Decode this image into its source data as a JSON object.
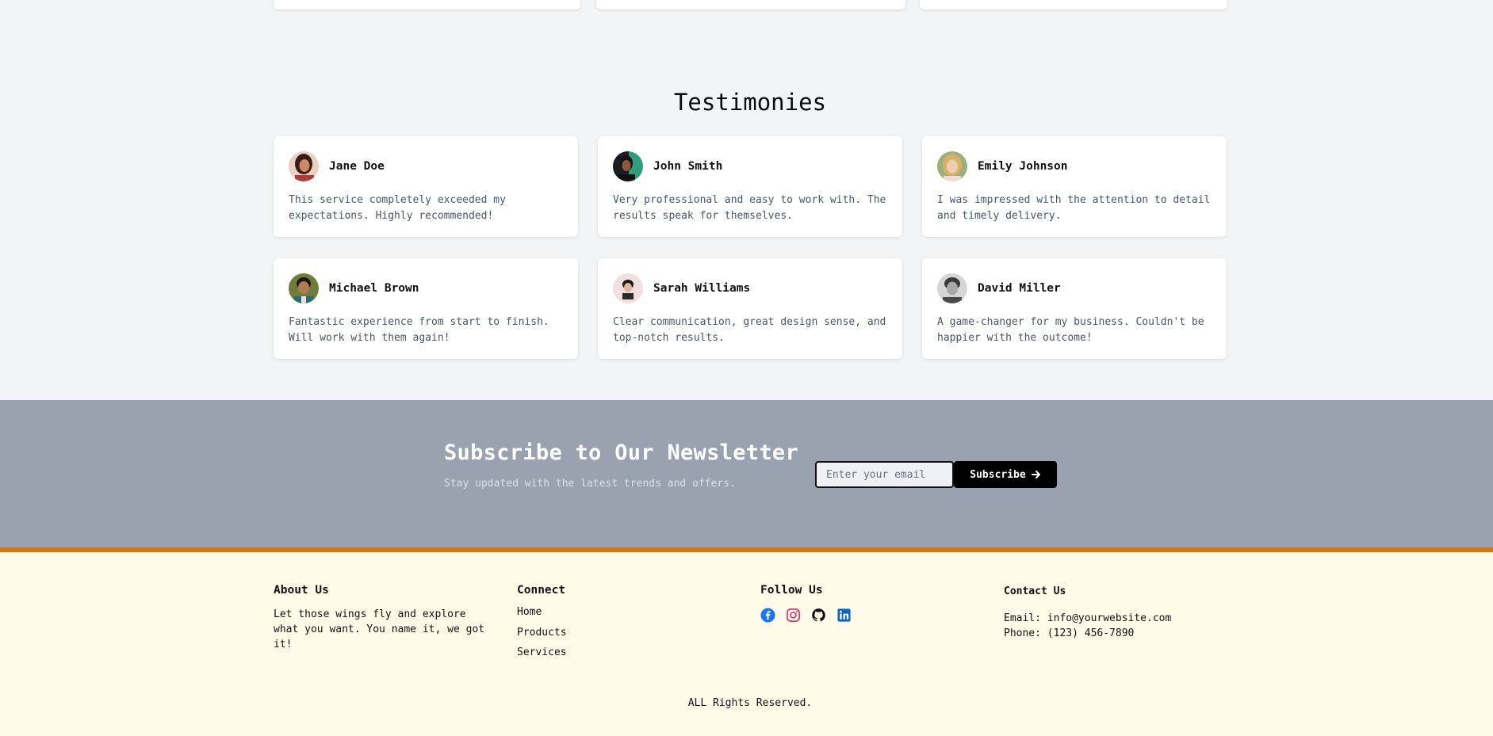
{
  "testimonies": {
    "title": "Testimonies",
    "items": [
      {
        "name": "Jane Doe",
        "quote": "This service completely exceeded my expectations. Highly recommended!"
      },
      {
        "name": "John Smith",
        "quote": "Very professional and easy to work with. The results speak for themselves."
      },
      {
        "name": "Emily Johnson",
        "quote": "I was impressed with the attention to detail and timely delivery."
      },
      {
        "name": "Michael Brown",
        "quote": "Fantastic experience from start to finish. Will work with them again!"
      },
      {
        "name": "Sarah Williams",
        "quote": "Clear communication, great design sense, and top-notch results."
      },
      {
        "name": "David Miller",
        "quote": "A game-changer for my business. Couldn't be happier with the outcome!"
      }
    ]
  },
  "newsletter": {
    "title": "Subscribe to Our Newsletter",
    "subtitle": "Stay updated with the latest trends and offers.",
    "input_placeholder": "Enter your email",
    "button_label": "Subscribe"
  },
  "footer": {
    "about": {
      "heading": "About Us",
      "text": "Let those wings fly and explore what you want. You name it, we got it!"
    },
    "connect": {
      "heading": "Connect",
      "links": [
        "Home",
        "Products",
        "Services"
      ]
    },
    "follow": {
      "heading": "Follow Us",
      "icons": [
        "facebook-icon",
        "instagram-icon",
        "github-icon",
        "linkedin-icon"
      ]
    },
    "contact": {
      "heading": "Contact Us",
      "email": "Email: info@yourwebsite.com",
      "phone": "Phone: (123) 456-7890"
    },
    "copyright": "ALL Rights Reserved."
  },
  "colors": {
    "page_bg": "#f3f4f6",
    "newsletter_bg": "#9aa1af",
    "accent_bar": "#d97706",
    "footer_bg": "#fefbe8",
    "facebook": "#1877f2",
    "instagram": "#e1306c",
    "linkedin": "#0a66c2"
  }
}
